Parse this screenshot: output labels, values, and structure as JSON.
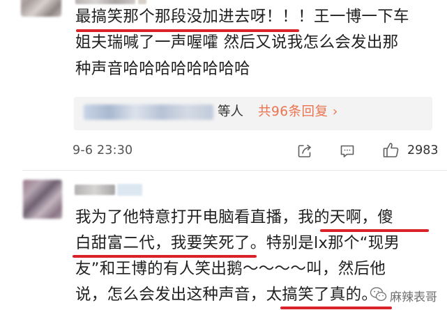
{
  "comments": [
    {
      "lines": [
        "最搞笑那个那段没加进去呀！！！王一博一下车",
        "姐夫瑞喊了一声喔嚯 然后又说我怎么会发出那",
        "种声音哈哈哈哈哈哈哈哈"
      ],
      "reply_preview": {
        "users_suffix": "等人",
        "count_link": "共96条回复 ›"
      },
      "timestamp": "9-6 23:30",
      "like_count": "2983"
    },
    {
      "lines": [
        "我为了他特意打开电脑看直播，我的天啊，傻",
        "白甜富二代，我要笑死了。特别是lx那个“现男",
        "友”和王博的有人笑出鹅～～～～叫，然后他",
        "说，怎么会发出这种声音，太搞笑了真的。"
      ]
    }
  ],
  "watermark": {
    "text": "麻辣表哥"
  },
  "colors": {
    "highlight_underline": "#d9222a",
    "reply_link": "#eb7350",
    "reply_box_bg": "#f3f3f3"
  },
  "icons": [
    "share-icon",
    "comment-icon",
    "like-icon",
    "wechat-icon"
  ]
}
